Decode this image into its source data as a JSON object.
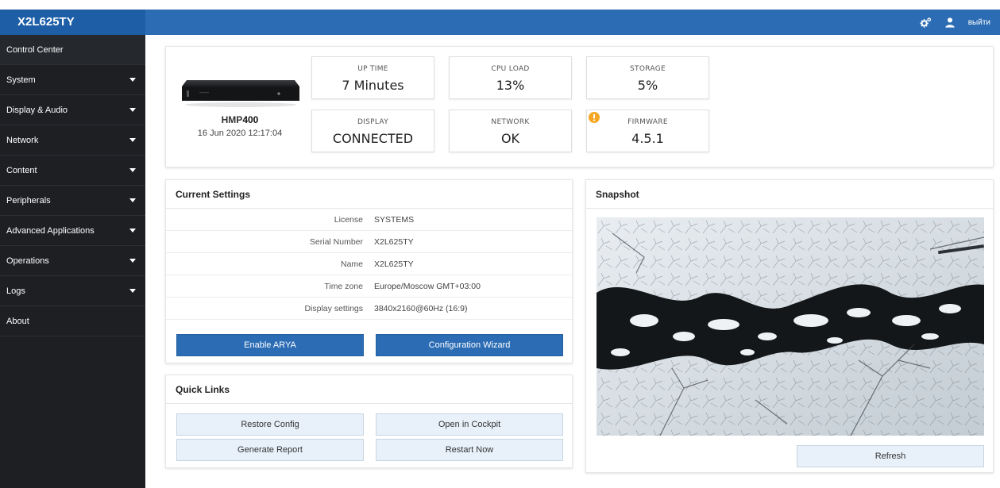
{
  "header": {
    "title": "X2L625TY",
    "logout_label": "выйти",
    "icons": [
      "gears-icon",
      "user-icon"
    ],
    "brand_color": "#2b6cb4"
  },
  "sidebar": {
    "items": [
      {
        "label": "Control Center",
        "expandable": false,
        "active": true
      },
      {
        "label": "System",
        "expandable": true
      },
      {
        "label": "Display & Audio",
        "expandable": true
      },
      {
        "label": "Network",
        "expandable": true
      },
      {
        "label": "Content",
        "expandable": true
      },
      {
        "label": "Peripherals",
        "expandable": true
      },
      {
        "label": "Advanced Applications",
        "expandable": true
      },
      {
        "label": "Operations",
        "expandable": true
      },
      {
        "label": "Logs",
        "expandable": true
      },
      {
        "label": "About",
        "expandable": false
      }
    ]
  },
  "device": {
    "model_prefix": "HMP",
    "model_number": "400",
    "datetime": "16 Jun 2020 12:17:04"
  },
  "stats": {
    "uptime": {
      "label": "UP TIME",
      "value": "7 Minutes"
    },
    "cpu": {
      "label": "CPU LOAD",
      "value": "13%"
    },
    "storage": {
      "label": "STORAGE",
      "value": "5%"
    },
    "display": {
      "label": "DISPLAY",
      "value": "CONNECTED"
    },
    "network": {
      "label": "NETWORK",
      "value": "OK"
    },
    "firmware": {
      "label": "FIRMWARE",
      "value": "4.5.1",
      "warning": true,
      "warning_color": "#f5a623"
    }
  },
  "current_settings": {
    "title": "Current Settings",
    "rows": [
      {
        "key": "License",
        "value": "SYSTEMS"
      },
      {
        "key": "Serial Number",
        "value": "X2L625TY"
      },
      {
        "key": "Name",
        "value": "X2L625TY"
      },
      {
        "key": "Time zone",
        "value": "Europe/Moscow GMT+03:00"
      },
      {
        "key": "Display settings",
        "value": "3840x2160@60Hz (16:9)"
      }
    ],
    "enable_arya_label": "Enable ARYA",
    "config_wizard_label": "Configuration Wizard"
  },
  "quick_links": {
    "title": "Quick Links",
    "restore_config_label": "Restore Config",
    "open_cockpit_label": "Open in Cockpit",
    "generate_report_label": "Generate Report",
    "restart_now_label": "Restart Now"
  },
  "snapshot": {
    "title": "Snapshot",
    "refresh_label": "Refresh"
  }
}
